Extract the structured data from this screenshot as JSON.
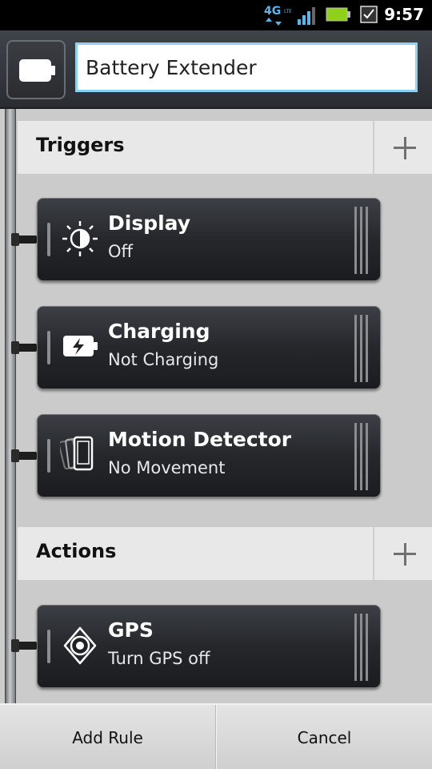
{
  "status_bar": {
    "time": "9:57",
    "network": "4G LTE"
  },
  "header": {
    "rule_name": "Battery Extender"
  },
  "triggers": {
    "title": "Triggers",
    "items": [
      {
        "icon": "brightness-icon",
        "title": "Display",
        "subtitle": "Off"
      },
      {
        "icon": "charging-battery-icon",
        "title": "Charging",
        "subtitle": "Not Charging"
      },
      {
        "icon": "motion-phone-icon",
        "title": "Motion Detector",
        "subtitle": "No Movement"
      }
    ]
  },
  "actions": {
    "title": "Actions",
    "items": [
      {
        "icon": "gps-icon",
        "title": "GPS",
        "subtitle": "Turn GPS off"
      }
    ]
  },
  "bottom": {
    "add_rule": "Add Rule",
    "cancel": "Cancel"
  },
  "colors": {
    "input_border": "#8fd1f0",
    "battery_green": "#8ed01a"
  }
}
